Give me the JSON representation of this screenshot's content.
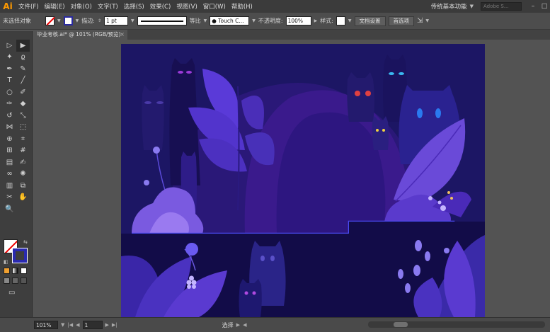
{
  "app": {
    "logo": "Ai"
  },
  "menu": {
    "items": [
      "文件(F)",
      "编辑(E)",
      "对象(O)",
      "文字(T)",
      "选择(S)",
      "效果(C)",
      "视图(V)",
      "窗口(W)",
      "帮助(H)"
    ],
    "workspace": "传统基本功能",
    "search_placeholder": "Adobe S..."
  },
  "control": {
    "selection_status": "未选择对象",
    "stroke_label": "描边:",
    "stroke_weight": "1 pt",
    "stroke_profile": "等比",
    "brush": "Touch C...",
    "opacity_label": "不透明度:",
    "opacity_value": "100%",
    "style_label": "样式:",
    "doc_setup_button": "文档设置",
    "preferences_button": "首选项"
  },
  "tab": {
    "title": "毕业考核.ai* @ 101% (RGB/预览)",
    "close": "×"
  },
  "tools": {
    "items": [
      {
        "icon": "selection-tool",
        "glyph": "▷"
      },
      {
        "icon": "direct-selection-tool",
        "glyph": "▶",
        "active": true
      },
      {
        "icon": "magic-wand-tool",
        "glyph": "✦"
      },
      {
        "icon": "lasso-tool",
        "glyph": "ϱ"
      },
      {
        "icon": "pen-tool",
        "glyph": "✒"
      },
      {
        "icon": "curvature-tool",
        "glyph": "✎"
      },
      {
        "icon": "type-tool",
        "glyph": "T"
      },
      {
        "icon": "line-tool",
        "glyph": "╱"
      },
      {
        "icon": "ellipse-tool",
        "glyph": "○"
      },
      {
        "icon": "paintbrush-tool",
        "glyph": "✐"
      },
      {
        "icon": "shaper-tool",
        "glyph": "✑"
      },
      {
        "icon": "eraser-tool",
        "glyph": "◆"
      },
      {
        "icon": "rotate-tool",
        "glyph": "↺"
      },
      {
        "icon": "scale-tool",
        "glyph": "⤡"
      },
      {
        "icon": "width-tool",
        "glyph": "⋈"
      },
      {
        "icon": "free-transform-tool",
        "glyph": "⬚"
      },
      {
        "icon": "shape-builder-tool",
        "glyph": "⊕"
      },
      {
        "icon": "live-paint-tool",
        "glyph": "⌗"
      },
      {
        "icon": "perspective-grid-tool",
        "glyph": "⊞"
      },
      {
        "icon": "mesh-tool",
        "glyph": "#"
      },
      {
        "icon": "gradient-tool",
        "glyph": "▤"
      },
      {
        "icon": "eyedropper-tool",
        "glyph": "✍"
      },
      {
        "icon": "blend-tool",
        "glyph": "∞"
      },
      {
        "icon": "symbol-sprayer-tool",
        "glyph": "✺"
      },
      {
        "icon": "column-graph-tool",
        "glyph": "▥"
      },
      {
        "icon": "artboard-tool",
        "glyph": "⧉"
      },
      {
        "icon": "slice-tool",
        "glyph": "✂"
      },
      {
        "icon": "hand-tool",
        "glyph": "✋"
      },
      {
        "icon": "zoom-tool",
        "glyph": "🔍"
      }
    ]
  },
  "status": {
    "zoom": "101%",
    "artboard_number": "1",
    "tool_name": "选择"
  },
  "colors": {
    "artboard_bg": "#1c1664",
    "accent_blue": "#2a2ab0",
    "none_red": "#e00000"
  }
}
